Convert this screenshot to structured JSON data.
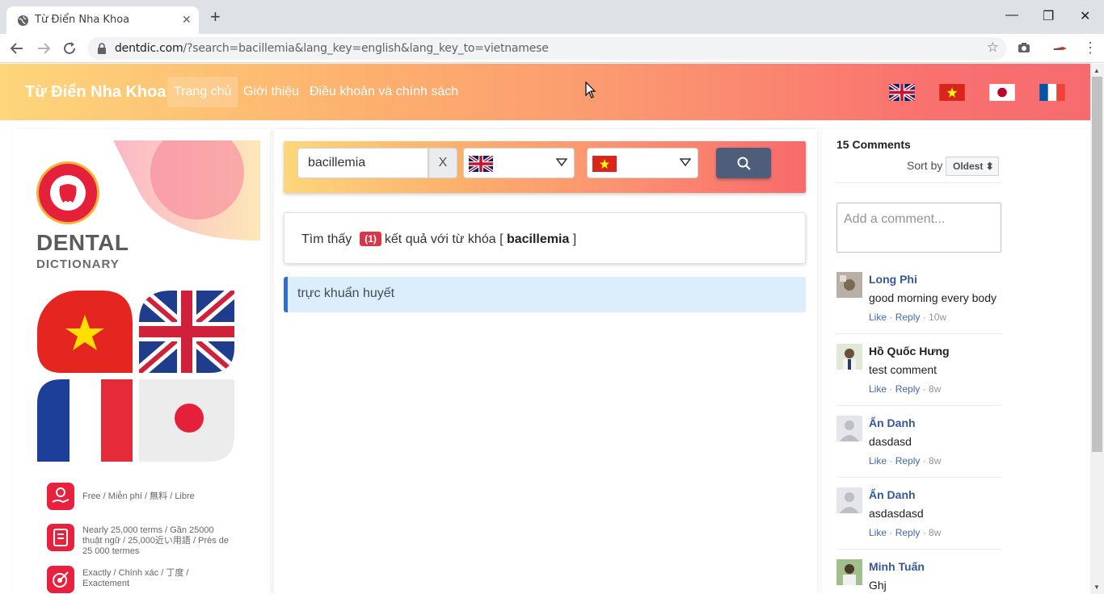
{
  "browser": {
    "tab_title": "Từ Điển Nha Khoa",
    "tab_close": "✕",
    "new_tab": "+",
    "url_host": "dentdic.com",
    "url_rest": "/?search=bacillemia&lang_key=english&lang_key_to=vietnamese",
    "window_min": "—",
    "window_restore": "❐",
    "window_close": "✕"
  },
  "navbar": {
    "brand": "Từ Điển Nha Khoa",
    "links": [
      "Trang chủ",
      "Giới thiệu",
      "Điều khoản và chính sách"
    ]
  },
  "promo": {
    "dental": "DENTAL",
    "dictionary": "DICTIONARY",
    "features": [
      "Free  /  Miễn phí  /  無料  /  Libre",
      "Nearly 25,000 terms  /  Gần 25000 thuật ngữ  /  25,000近い用語  /  Près de 25 000 termes",
      "Exactly  /  Chính xác  /  丁度  /  Exactement"
    ]
  },
  "search": {
    "query": "bacillemia",
    "clear_label": "X",
    "from_lang": "english",
    "to_lang": "vietnamese"
  },
  "result": {
    "prefix": "Tìm thấy",
    "count": "(1)",
    "middle": "kết quả với từ khóa [",
    "keyword": "bacillemia",
    "suffix": "]",
    "translation": "trực khuẩn huyết"
  },
  "comments": {
    "count_label": "15 Comments",
    "sort_label": "Sort by",
    "sort_value": "Oldest ⬍",
    "placeholder": "Add a comment...",
    "like": "Like",
    "reply": "Reply",
    "items": [
      {
        "name": "Long Phi",
        "text": "good morning every body",
        "time": "10w"
      },
      {
        "name": "Hồ Quốc Hưng",
        "text": "test comment",
        "time": "8w"
      },
      {
        "name": "Ẩn Danh",
        "text": "dasdasd",
        "time": "8w"
      },
      {
        "name": "Ẩn Danh",
        "text": "asdasdasd",
        "time": "8w"
      },
      {
        "name": "Minh Tuấn",
        "text": "Ghj",
        "time": ""
      }
    ]
  },
  "colors": {
    "accent_red": "#e8213e",
    "search_button": "#4e5d7a",
    "link_blue": "#365899"
  }
}
